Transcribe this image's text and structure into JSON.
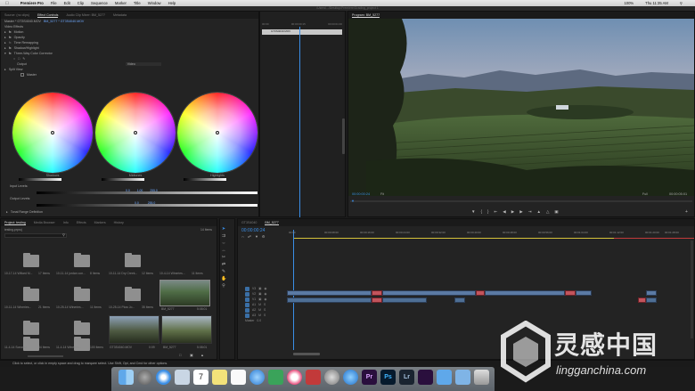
{
  "menubar": {
    "app": "Premiere Pro",
    "items": [
      "File",
      "Edit",
      "Clip",
      "Sequence",
      "Marker",
      "Title",
      "Window",
      "Help"
    ],
    "status": [
      "100%",
      "Thu 11:35 AM"
    ]
  },
  "titlebar": "/Users/.../Desktop/Premiere/Grading_project 1",
  "effect_controls": {
    "tabs": [
      "Source: (no clips)",
      "Effect Controls",
      "Audio Clip Mixer: BM_5277",
      "Metadata"
    ],
    "active_tab": 1,
    "master_label": "Master * GT3S4040.MOV",
    "clip_label": "BM_5277 * GT3S4040.MOV",
    "video_effects_label": "Video Effects",
    "effects": [
      "Motion",
      "Opacity",
      "Time Remapping",
      "Shadow/Highlight",
      "Three-Way Color Corrector"
    ],
    "output_label": "Output",
    "output_value": "Video",
    "split_view_label": "Split View",
    "master_toggle": "Master",
    "wheels": [
      {
        "label": "Shadows"
      },
      {
        "label": "Midtones"
      },
      {
        "label": "Highlights"
      }
    ],
    "input_levels_label": "Input Levels:",
    "output_levels_label": "Output Levels:",
    "input_levels_values": [
      "0.0",
      "1.00",
      "255.0"
    ],
    "output_levels_values": [
      "0.0",
      "255.0"
    ],
    "tonal_range_label": "Tonal Range Definition",
    "timecode": "00:00:00:24"
  },
  "mini_timeline": {
    "times": [
      "00:00",
      "00:00:00:15",
      "00:00:01:00"
    ],
    "clip": "GT3S4040.MOV"
  },
  "program": {
    "tab": "Program: BM_5277",
    "timecode_in": "00:00:00:24",
    "fit_value": "Fit",
    "quality": "Full",
    "timecode_out": "00:00:05:01"
  },
  "project": {
    "tabs": [
      "Project: testing",
      "Media Browser",
      "Info",
      "Effects",
      "Markers",
      "History"
    ],
    "active_tab": 0,
    "project_name": "testing.prproj",
    "item_count": "14 Items",
    "bins": [
      {
        "name": "10-17-14 Willard M...",
        "count": "17 Items"
      },
      {
        "name": "10-11-14 jordan con...",
        "count": "8 Items"
      },
      {
        "name": "10-11-14 Dry Creek...",
        "count": "12 Items"
      },
      {
        "name": "10-4-14 Wineries...",
        "count": "11 Items"
      },
      {
        "name": "10-11-14 Wineries...",
        "count": "21 Items"
      },
      {
        "name": "10-25-14 Wineries...",
        "count": "11 Items"
      },
      {
        "name": "10-25-14 Plow Jo...",
        "count": "35 Items"
      },
      {
        "name": "10-29-14 Wine...",
        "count": "4 Items"
      },
      {
        "name": "11-4-14 Sonoma",
        "count": "34 Items"
      },
      {
        "name": "11-4-14 Wineries...",
        "count": "100 Items"
      }
    ],
    "clips": [
      {
        "name": "BM_5277",
        "duration": "5:08:01"
      },
      {
        "name": "GT3S4040.MOV",
        "duration": "0:09"
      },
      {
        "name": "BM_5277",
        "duration": "5:08:01"
      }
    ]
  },
  "timeline": {
    "tabs": [
      "GT3S4040",
      "BM_5277"
    ],
    "active_tab": 1,
    "timecode": "00:00:00:24",
    "ruler": [
      "00:00",
      "00:00:08:00",
      "00:00:16:00",
      "00:00:24:00",
      "00:00:32:00",
      "00:00:40:00",
      "00:00:48:00",
      "00:00:56:00",
      "00:01:04:00",
      "00:01:12:00",
      "00:01:20:00",
      "00:01:28:00"
    ],
    "tracks": [
      "V3",
      "V2",
      "V1",
      "A1",
      "A2",
      "A3",
      "Master"
    ],
    "master_value": "0.0"
  },
  "statusbar": "Click to select, or click in empty space and drag to marquee select. Use Shift, Opt, and Cmd for other options.",
  "watermark": {
    "cn": "灵感中国",
    "url": "lingganchina.com"
  },
  "colors": {
    "accent": "#3a8ee6",
    "clip_video": "#5b7aa4",
    "clip_red": "#c2545c",
    "panel": "#232323"
  }
}
